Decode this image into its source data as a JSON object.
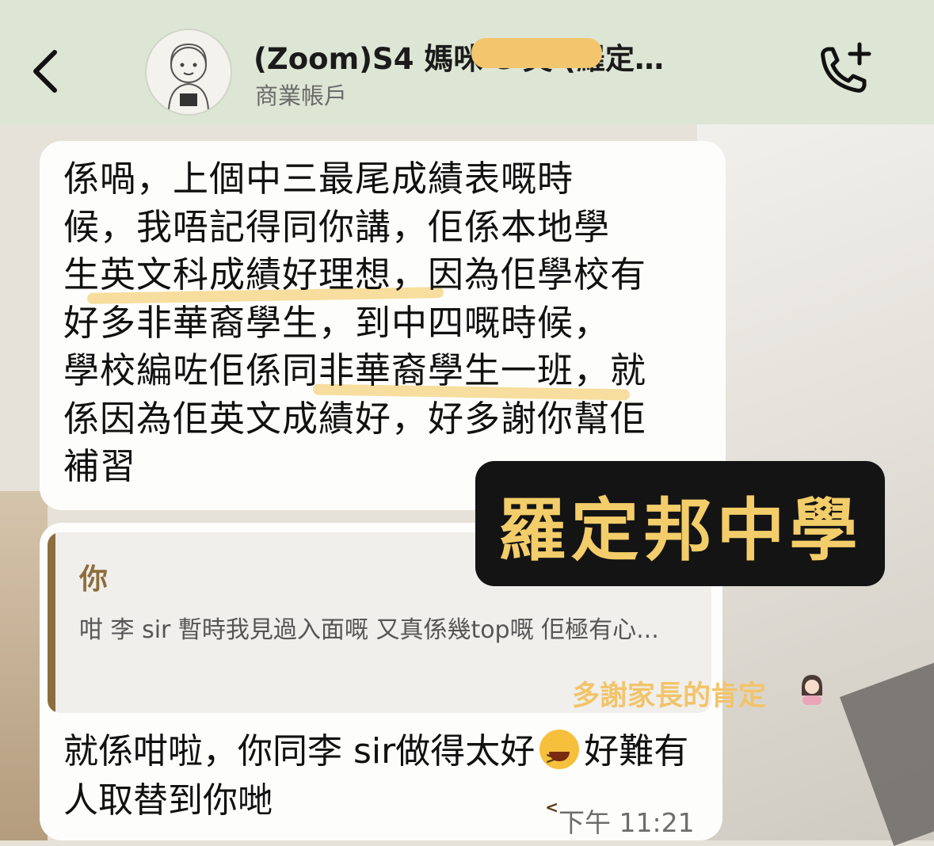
{
  "header": {
    "back_icon": "chevron-left-icon",
    "title": "(Zoom)S4 媽咪 e 英 (羅定…",
    "subtitle": "商業帳戶",
    "call_icon": "phone-plus-icon"
  },
  "messages": {
    "incoming_1": "係喎，上個中三最尾成績表嘅時\n候，我唔記得同你講，佢係本地學\n生英文科成績好理想，因為佢學校有\n好多非華裔學生，到中四嘅時候，\n學校編咗佢係同非華裔學生一班，就\n係因為佢英文成績好，好多謝你幫佢\n補習",
    "quote_name": "你",
    "quote_text": "咁 李 sir 暫時我見過入面嘅 又真係幾top嘅 佢極有心...",
    "incoming_2_part1": "就係咁啦，你同李 sir做得太好",
    "incoming_2_part2": "好難有人取替到你哋",
    "time": "下午 11:21"
  },
  "overlay": {
    "sticker_text": "羅定邦中學",
    "thanks_text": "多謝家長的肯定"
  },
  "colors": {
    "header_bg": "#dde6d5",
    "accent_gold": "#f3cd6a",
    "quote_bar": "#8c6e3d"
  }
}
